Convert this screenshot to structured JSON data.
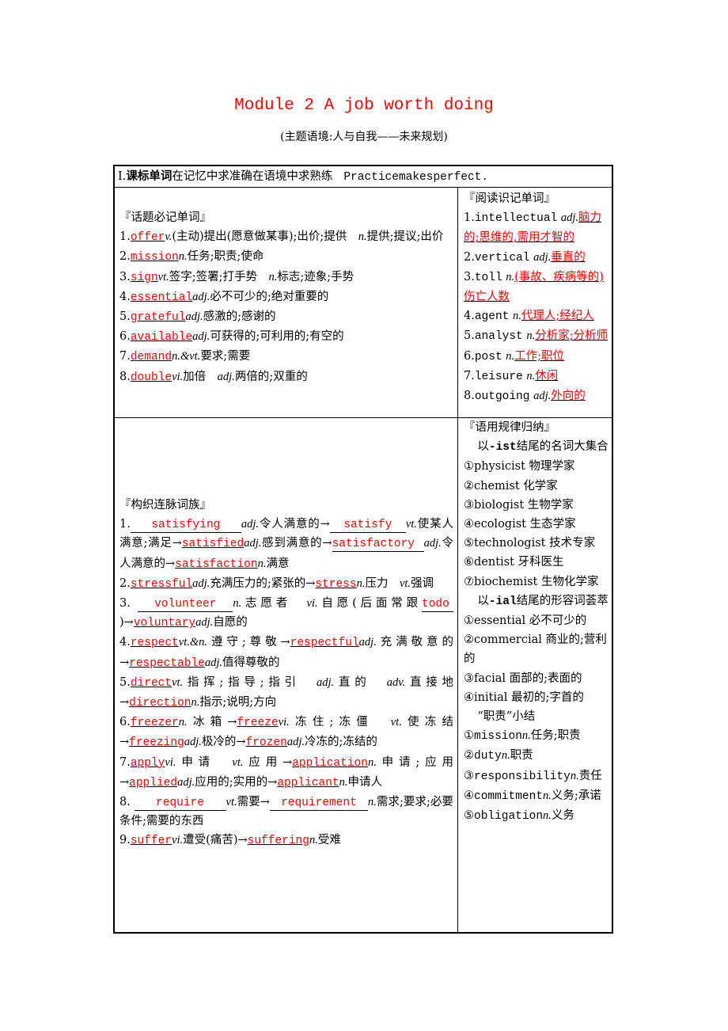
{
  "title": "Module 2 A job worth doing",
  "subtitle": "(主题语境:人与自我——未来规划)",
  "header": {
    "num": "Ⅰ.",
    "bold": "课标单词",
    "text": "在记忆中求准确在语境中求熟练",
    "english": "Practicemakesperfect."
  },
  "topic_words": {
    "heading": "『话题必记单词』",
    "items": [
      {
        "num": "1.",
        "word": "offer",
        "pos": "v.",
        "def": "(主动)提出(愿意做某事);出价;提供　",
        "pos2": "n.",
        "def2": "提供;提议;出价"
      },
      {
        "num": "2.",
        "word": "mission",
        "pos": "n.",
        "def": "任务;职责;使命"
      },
      {
        "num": "3.",
        "word": "sign",
        "pos": "vt.",
        "def": "签字;签署;打手势　",
        "pos2": "n.",
        "def2": "标志;迹象;手势"
      },
      {
        "num": "4.",
        "word": "essential",
        "pos": "adj.",
        "def": "必不可少的;绝对重要的"
      },
      {
        "num": "5.",
        "word": "grateful",
        "pos": "adj.",
        "def": "感激的;感谢的"
      },
      {
        "num": "6.",
        "word": "available",
        "pos": "adj.",
        "def": "可获得的;可利用的;有空的"
      },
      {
        "num": "7.",
        "word": "demand",
        "pos": "n.&vt.",
        "def": "要求;需要"
      },
      {
        "num": "8.",
        "word": "double",
        "pos": "vi.",
        "def": "加倍　",
        "pos2": "adj.",
        "def2": "两倍的;双重的"
      }
    ]
  },
  "reading_words": {
    "heading": "『阅读识记单词』",
    "items": [
      {
        "num": "1.",
        "word": "intellectual",
        "pos": "adj.",
        "answer": "脑力的;思维的,需用才智的"
      },
      {
        "num": "2.",
        "word": "vertical",
        "pos": "adj.",
        "answer": "垂直的"
      },
      {
        "num": "3.",
        "word": "toll",
        "pos": "n.",
        "answer": "(事故、疾病等的)伤亡人数"
      },
      {
        "num": "4.",
        "word": "agent",
        "pos": "n.",
        "answer": "代理人;经纪人"
      },
      {
        "num": "5.",
        "word": "analyst",
        "pos": "n.",
        "answer": "分析家;分析师"
      },
      {
        "num": "6.",
        "word": "post",
        "pos": "n.",
        "answer": "工作;职位"
      },
      {
        "num": "7.",
        "word": "leisure",
        "pos": "n.",
        "answer": "休闲"
      },
      {
        "num": "8.",
        "word": "outgoing",
        "pos": "adj.",
        "answer": "外向的"
      }
    ]
  },
  "word_family": {
    "heading": "『构织连脉词族』",
    "entries": {
      "e1": {
        "num": "1.",
        "w1": "satisfying",
        "p1": "adj.",
        "d1": "令人满意的→",
        "w2": "satisfy",
        "p2": "vt.",
        "d2": "使某人满意;满足→",
        "w3": "satisfied",
        "p3": "adj.",
        "d3": "感到满意的→",
        "w4": "satisfactory",
        "p4": "adj.",
        "d4": "令人满意的→",
        "w5": "satisfaction",
        "p5": "n.",
        "d5": "满意"
      },
      "e2": {
        "num": "2.",
        "w1": "stressful",
        "p1": "adj.",
        "d1": "充满压力的;紧张的→",
        "w2": "stress",
        "p2": "n.",
        "d2": "压力　",
        "p3": "vt.",
        "d3": "强调"
      },
      "e3": {
        "num": "3.",
        "w1": "volunteer",
        "p1": "n.",
        "d1": "志愿者　",
        "p2": "vi.",
        "d2": "自愿(后面常跟",
        "w2": "todo",
        "d3": ")→",
        "w3": "voluntary",
        "p3": "adj.",
        "d4": "自愿的"
      },
      "e4": {
        "num": "4.",
        "w1": "respect",
        "p1": "vt.&n.",
        "d1": "遵守;尊敬→",
        "w2": "respectful",
        "p2": "adj.",
        "d2": "充满敬意的→",
        "w3": "respectable",
        "p3": "adj.",
        "d3": "值得尊敬的"
      },
      "e5": {
        "num": "5.",
        "w1": "direct",
        "p1": "vt.",
        "d1": "指挥;指导;指引　",
        "p2": "adj.",
        "d2": "直的　",
        "p3": "adv.",
        "d3": "直接地→",
        "w2": "direction",
        "p4": "n.",
        "d4": "指示;说明;方向"
      },
      "e6": {
        "num": "6.",
        "w1": "freezer",
        "p1": "n.",
        "d1": "冰箱→",
        "w2": "freeze",
        "p2": "vi.",
        "d2": "冻住;冻僵　",
        "p3": "vt.",
        "d3": "使冻结→",
        "w3": "freezing",
        "p4": "adj.",
        "d4": "极冷的→",
        "w4": "frozen",
        "p5": "adj.",
        "d5": "冷冻的;冻结的"
      },
      "e7": {
        "num": "7.",
        "w1": "apply",
        "p1": "vi.",
        "d1": "申请　",
        "p2": "vt.",
        "d2": "应用→",
        "w2": "application",
        "p3": "n.",
        "d3": "申请;应用→",
        "w3": "applied",
        "p4": "adj.",
        "d4": "应用的;实用的→",
        "w4": "applicant",
        "p5": "n.",
        "d5": "申请人"
      },
      "e8": {
        "num": "8.",
        "w1": "require",
        "p1": "vt.",
        "d1": "需要→",
        "w2": "requirement",
        "p2": "n.",
        "d2": "需求;要求;必要条件;需要的东西"
      },
      "e9": {
        "num": "9.",
        "w1": "suffer",
        "p1": "vi.",
        "d1": "遭受(痛苦)→",
        "w2": "suffering",
        "p2": "n.",
        "d2": "受难"
      }
    }
  },
  "usage_rules": {
    "heading": "『语用规律归纳』",
    "ist": {
      "intro_pre": "以",
      "intro_suffix": "-ist",
      "intro_post": "结尾的名词大集合",
      "items": [
        "①physicist 物理学家",
        "②chemist 化学家",
        "③biologist 生物学家",
        "④ecologist 生态学家",
        "⑤technologist 技术专家",
        "⑥dentist 牙科医生",
        "⑦biochemist 生物化学家"
      ]
    },
    "ial": {
      "intro_pre": "以",
      "intro_suffix": "-ial",
      "intro_post": "结尾的形容词荟萃",
      "items": [
        "①essential 必不可少的",
        "②commercial 商业的;营利的",
        "③facial 面部的;表面的",
        "④initial 最初的;字首的"
      ]
    },
    "duty": {
      "intro": "“职责”小结",
      "items": [
        {
          "mark": "①",
          "word": "mission",
          "pos": "n.",
          "def": "任务;职责"
        },
        {
          "mark": "②",
          "word": "duty",
          "pos": "n.",
          "def": "职责"
        },
        {
          "mark": "③",
          "word": "responsibility",
          "pos": "n.",
          "def": "责任"
        },
        {
          "mark": "④",
          "word": "commitment",
          "pos": "n.",
          "def": "义务;承诺"
        },
        {
          "mark": "⑤",
          "word": "obligation",
          "pos": "n.",
          "def": "义务"
        }
      ]
    }
  }
}
